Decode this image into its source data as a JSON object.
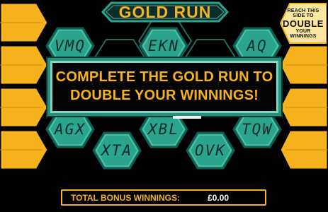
{
  "game": {
    "title": "GOLD RUN",
    "reach_badge": {
      "line1": "REACH THIS",
      "line2": "SIDE TO",
      "highlight": "DOUBLE",
      "line3": "YOUR",
      "line4": "WINNINGS"
    },
    "message": {
      "line1": "COMPLETE THE GOLD RUN TO",
      "line2": "DOUBLE YOUR WINNINGS!"
    },
    "hexes": [
      {
        "label": "VMQ"
      },
      {
        "label": "EKN"
      },
      {
        "label": "AQ"
      },
      {
        "label": "AGX"
      },
      {
        "label": "XBL"
      },
      {
        "label": "TQW"
      },
      {
        "label": "XTA"
      },
      {
        "label": "OVK"
      },
      {
        "label": ""
      },
      {
        "label": ""
      },
      {
        "label": ""
      }
    ],
    "bonus": {
      "label": "TOTAL BONUS WINNINGS:",
      "value": "£0.00"
    }
  },
  "colors": {
    "gold": "#f6b21c",
    "gold_light": "#ffd24a",
    "hex_fill": "#2aa58c",
    "hex_dark": "#0f5e4f",
    "hex_light": "#8ff0d8",
    "background": "#000000"
  }
}
